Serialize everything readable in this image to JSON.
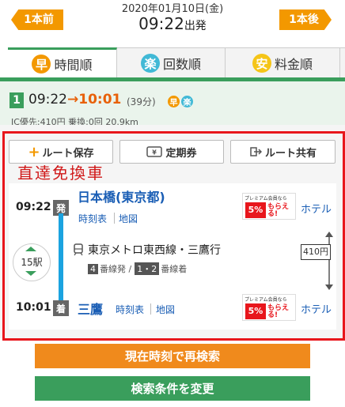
{
  "header": {
    "prev_label": "1本前",
    "next_label": "1本後",
    "date": "2020年01月10日(金)",
    "time": "09:22",
    "time_suffix": "出発"
  },
  "tabs": [
    {
      "icon": "早",
      "label": "時間順",
      "active": true
    },
    {
      "icon": "楽",
      "label": "回数順",
      "active": false
    },
    {
      "icon": "安",
      "label": "料金順",
      "active": false
    }
  ],
  "summary": {
    "route_number": "1",
    "depart": "09:22",
    "arrow": "→",
    "arrive": "10:01",
    "duration": "(39分)",
    "icon_fast": "早",
    "icon_easy": "楽",
    "subline": "IC優先:410円 乗換:0回 20.9km"
  },
  "actions": {
    "save_label": "ルート保存",
    "pass_label": "定期券",
    "share_label": "ルート共有"
  },
  "overlay_text": "直達免換車",
  "route": {
    "from_time": "09:22",
    "from_badge": "発",
    "from_station": "日本橋(東京都)",
    "arrive_time": "10:01",
    "arrive_badge": "着",
    "to_station": "三鷹",
    "timetable_label": "時刻表",
    "map_label": "地図",
    "hotel_label": "ホテル",
    "stops": "15駅",
    "line_name": "東京メトロ東西線・三鷹行",
    "depart_platform_num": "4",
    "depart_platform_text": "番線発 /",
    "arrive_platform_num": "1・2",
    "arrive_platform_text": "番線着",
    "fare": "410円",
    "promo_top": "プレミアム会員なら",
    "promo_num": "5%",
    "promo_text": "もらえる!"
  },
  "buttons": {
    "research_label": "現在時刻で再検索",
    "change_label": "検索条件を変更"
  },
  "colors": {
    "accent_orange": "#f39800",
    "green": "#3a9e5c",
    "link_blue": "#1a5eb5",
    "line_blue": "#1ba3e0",
    "highlight_red": "#e8161c"
  }
}
